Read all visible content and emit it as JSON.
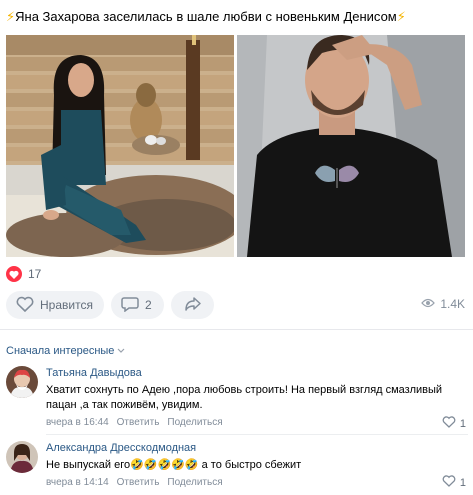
{
  "post": {
    "title_prefix_icon": "lightning-emoji",
    "title": "Яна Захарова заселилась в шале любви с новеньким Денисом",
    "title_suffix_icon": "lightning-emoji",
    "images": [
      {
        "name": "woman-in-chalet-photo"
      },
      {
        "name": "man-in-black-tshirt-photo"
      }
    ]
  },
  "reactions": {
    "icon": "heart-icon",
    "count": "17"
  },
  "actions": {
    "like_label": "Нравится",
    "comment_count": "2",
    "share_icon": "share-arrow-icon"
  },
  "views": {
    "icon": "eye-icon",
    "count": "1.4K"
  },
  "comments_sort": {
    "label": "Сначала интересные"
  },
  "comments": [
    {
      "author": "Татьяна Давыдова",
      "text": "Хватит сохнуть по Адею ,пора любовь строить! На первый взгляд смазливый пацан ,а так поживём, увидим.",
      "time": "вчера в 16:44",
      "reply_label": "Ответить",
      "share_label": "Поделиться",
      "likes": "1"
    },
    {
      "author": "Александра Дресскодмодная",
      "text_start": "Не выпускай его",
      "emojis": "🤣🤣🤣🤣🤣",
      "text_end": " а то быстро сбежит",
      "time": "вчера в 14:14",
      "reply_label": "Ответить",
      "share_label": "Поделиться",
      "likes": "1"
    }
  ],
  "colors": {
    "accent_link": "#2a5885",
    "like_red": "#ff3347",
    "button_bg": "#f0f2f5",
    "meta_grey": "#818c99"
  }
}
